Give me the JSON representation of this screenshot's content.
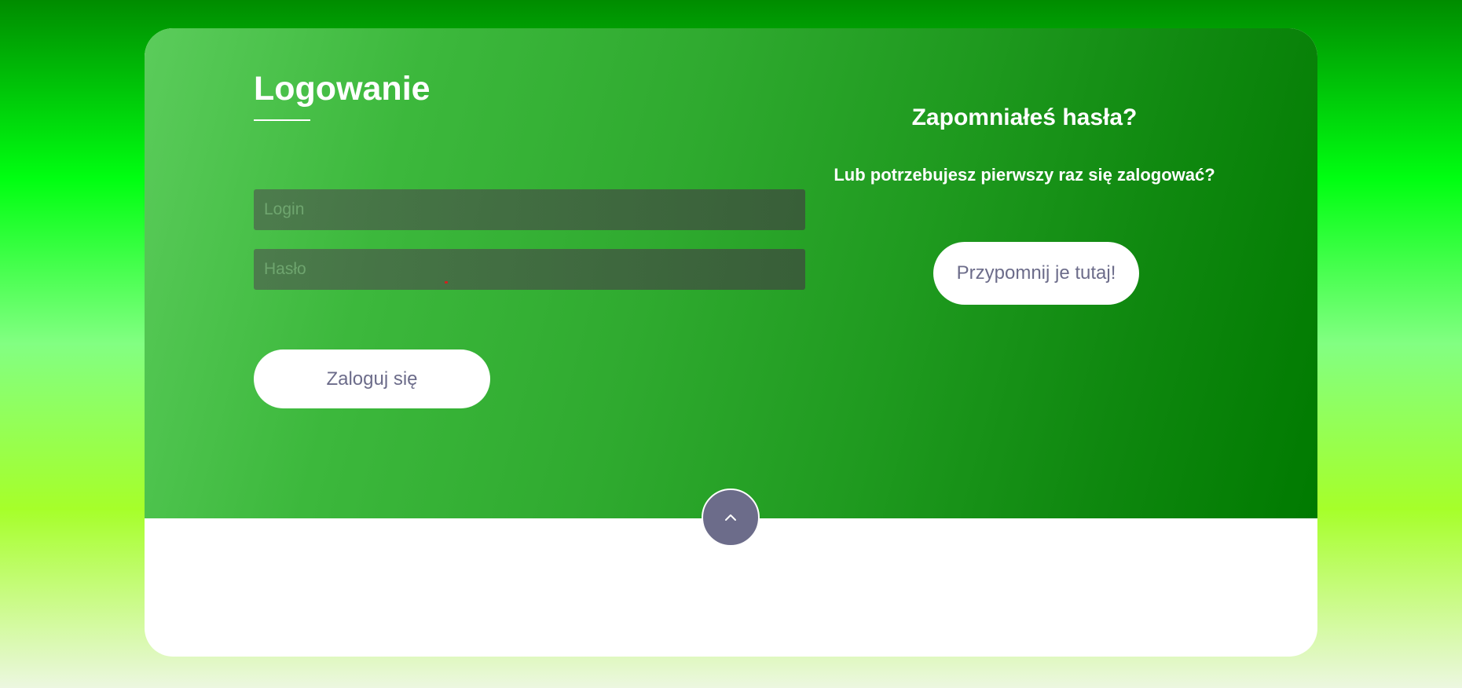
{
  "login": {
    "title": "Logowanie",
    "login_placeholder": "Login",
    "password_placeholder": "Hasło",
    "submit_label": "Zaloguj się"
  },
  "forgot": {
    "title": "Zapomniałeś hasła?",
    "subtitle": "Lub potrzebujesz pierwszy raz się zalogować?",
    "button_label": "Przypomnij je tutaj!"
  },
  "scroll_top": {
    "icon": "chevron-up-icon"
  },
  "colors": {
    "button_text": "#6c6c8a",
    "accent_circle": "#6c6c8a",
    "card_gradient_start": "#5bcc5b",
    "card_gradient_end": "#007a00"
  }
}
